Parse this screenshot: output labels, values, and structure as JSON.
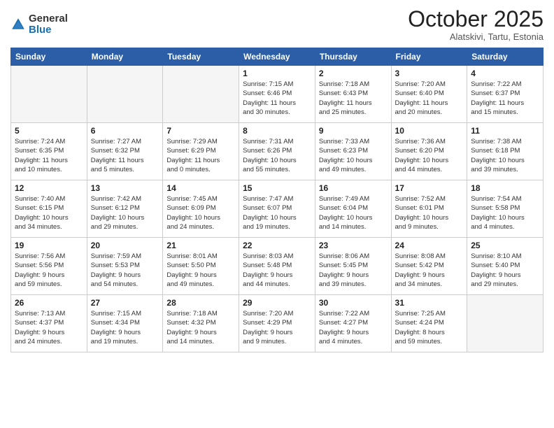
{
  "header": {
    "logo_general": "General",
    "logo_blue": "Blue",
    "month_title": "October 2025",
    "location": "Alatskivi, Tartu, Estonia"
  },
  "calendar": {
    "days_of_week": [
      "Sunday",
      "Monday",
      "Tuesday",
      "Wednesday",
      "Thursday",
      "Friday",
      "Saturday"
    ],
    "weeks": [
      [
        {
          "day": "",
          "info": ""
        },
        {
          "day": "",
          "info": ""
        },
        {
          "day": "",
          "info": ""
        },
        {
          "day": "1",
          "info": "Sunrise: 7:15 AM\nSunset: 6:46 PM\nDaylight: 11 hours\nand 30 minutes."
        },
        {
          "day": "2",
          "info": "Sunrise: 7:18 AM\nSunset: 6:43 PM\nDaylight: 11 hours\nand 25 minutes."
        },
        {
          "day": "3",
          "info": "Sunrise: 7:20 AM\nSunset: 6:40 PM\nDaylight: 11 hours\nand 20 minutes."
        },
        {
          "day": "4",
          "info": "Sunrise: 7:22 AM\nSunset: 6:37 PM\nDaylight: 11 hours\nand 15 minutes."
        }
      ],
      [
        {
          "day": "5",
          "info": "Sunrise: 7:24 AM\nSunset: 6:35 PM\nDaylight: 11 hours\nand 10 minutes."
        },
        {
          "day": "6",
          "info": "Sunrise: 7:27 AM\nSunset: 6:32 PM\nDaylight: 11 hours\nand 5 minutes."
        },
        {
          "day": "7",
          "info": "Sunrise: 7:29 AM\nSunset: 6:29 PM\nDaylight: 11 hours\nand 0 minutes."
        },
        {
          "day": "8",
          "info": "Sunrise: 7:31 AM\nSunset: 6:26 PM\nDaylight: 10 hours\nand 55 minutes."
        },
        {
          "day": "9",
          "info": "Sunrise: 7:33 AM\nSunset: 6:23 PM\nDaylight: 10 hours\nand 49 minutes."
        },
        {
          "day": "10",
          "info": "Sunrise: 7:36 AM\nSunset: 6:20 PM\nDaylight: 10 hours\nand 44 minutes."
        },
        {
          "day": "11",
          "info": "Sunrise: 7:38 AM\nSunset: 6:18 PM\nDaylight: 10 hours\nand 39 minutes."
        }
      ],
      [
        {
          "day": "12",
          "info": "Sunrise: 7:40 AM\nSunset: 6:15 PM\nDaylight: 10 hours\nand 34 minutes."
        },
        {
          "day": "13",
          "info": "Sunrise: 7:42 AM\nSunset: 6:12 PM\nDaylight: 10 hours\nand 29 minutes."
        },
        {
          "day": "14",
          "info": "Sunrise: 7:45 AM\nSunset: 6:09 PM\nDaylight: 10 hours\nand 24 minutes."
        },
        {
          "day": "15",
          "info": "Sunrise: 7:47 AM\nSunset: 6:07 PM\nDaylight: 10 hours\nand 19 minutes."
        },
        {
          "day": "16",
          "info": "Sunrise: 7:49 AM\nSunset: 6:04 PM\nDaylight: 10 hours\nand 14 minutes."
        },
        {
          "day": "17",
          "info": "Sunrise: 7:52 AM\nSunset: 6:01 PM\nDaylight: 10 hours\nand 9 minutes."
        },
        {
          "day": "18",
          "info": "Sunrise: 7:54 AM\nSunset: 5:58 PM\nDaylight: 10 hours\nand 4 minutes."
        }
      ],
      [
        {
          "day": "19",
          "info": "Sunrise: 7:56 AM\nSunset: 5:56 PM\nDaylight: 9 hours\nand 59 minutes."
        },
        {
          "day": "20",
          "info": "Sunrise: 7:59 AM\nSunset: 5:53 PM\nDaylight: 9 hours\nand 54 minutes."
        },
        {
          "day": "21",
          "info": "Sunrise: 8:01 AM\nSunset: 5:50 PM\nDaylight: 9 hours\nand 49 minutes."
        },
        {
          "day": "22",
          "info": "Sunrise: 8:03 AM\nSunset: 5:48 PM\nDaylight: 9 hours\nand 44 minutes."
        },
        {
          "day": "23",
          "info": "Sunrise: 8:06 AM\nSunset: 5:45 PM\nDaylight: 9 hours\nand 39 minutes."
        },
        {
          "day": "24",
          "info": "Sunrise: 8:08 AM\nSunset: 5:42 PM\nDaylight: 9 hours\nand 34 minutes."
        },
        {
          "day": "25",
          "info": "Sunrise: 8:10 AM\nSunset: 5:40 PM\nDaylight: 9 hours\nand 29 minutes."
        }
      ],
      [
        {
          "day": "26",
          "info": "Sunrise: 7:13 AM\nSunset: 4:37 PM\nDaylight: 9 hours\nand 24 minutes."
        },
        {
          "day": "27",
          "info": "Sunrise: 7:15 AM\nSunset: 4:34 PM\nDaylight: 9 hours\nand 19 minutes."
        },
        {
          "day": "28",
          "info": "Sunrise: 7:18 AM\nSunset: 4:32 PM\nDaylight: 9 hours\nand 14 minutes."
        },
        {
          "day": "29",
          "info": "Sunrise: 7:20 AM\nSunset: 4:29 PM\nDaylight: 9 hours\nand 9 minutes."
        },
        {
          "day": "30",
          "info": "Sunrise: 7:22 AM\nSunset: 4:27 PM\nDaylight: 9 hours\nand 4 minutes."
        },
        {
          "day": "31",
          "info": "Sunrise: 7:25 AM\nSunset: 4:24 PM\nDaylight: 8 hours\nand 59 minutes."
        },
        {
          "day": "",
          "info": ""
        }
      ]
    ]
  }
}
